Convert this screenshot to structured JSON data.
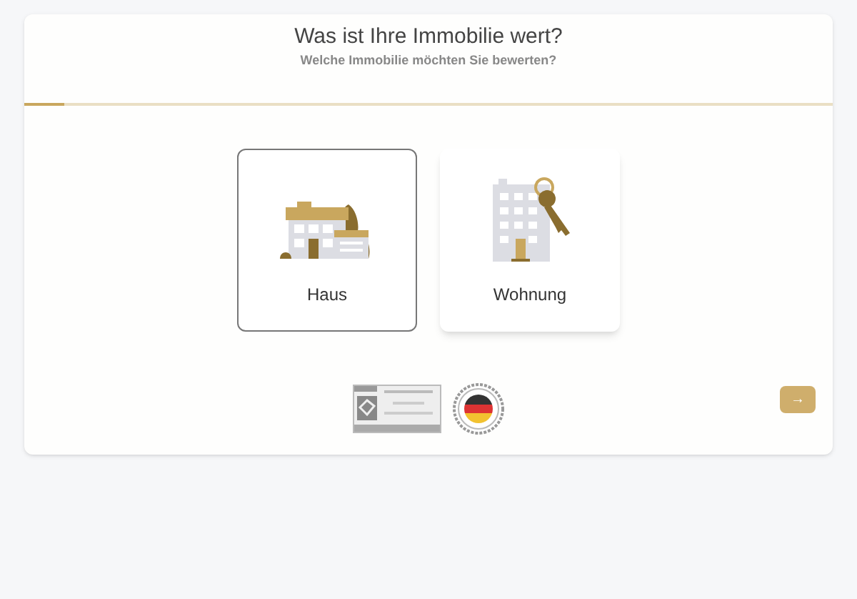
{
  "title": "Was ist Ihre Immobilie wert?",
  "subtitle": "Welche Immobilie möchten Sie bewerten?",
  "progress": {
    "level": 0.05
  },
  "options": [
    {
      "label": "Haus",
      "kind": "house",
      "selected": true
    },
    {
      "label": "Wohnung",
      "kind": "apartment",
      "selected": false
    }
  ],
  "next_button": {
    "label": "→"
  }
}
